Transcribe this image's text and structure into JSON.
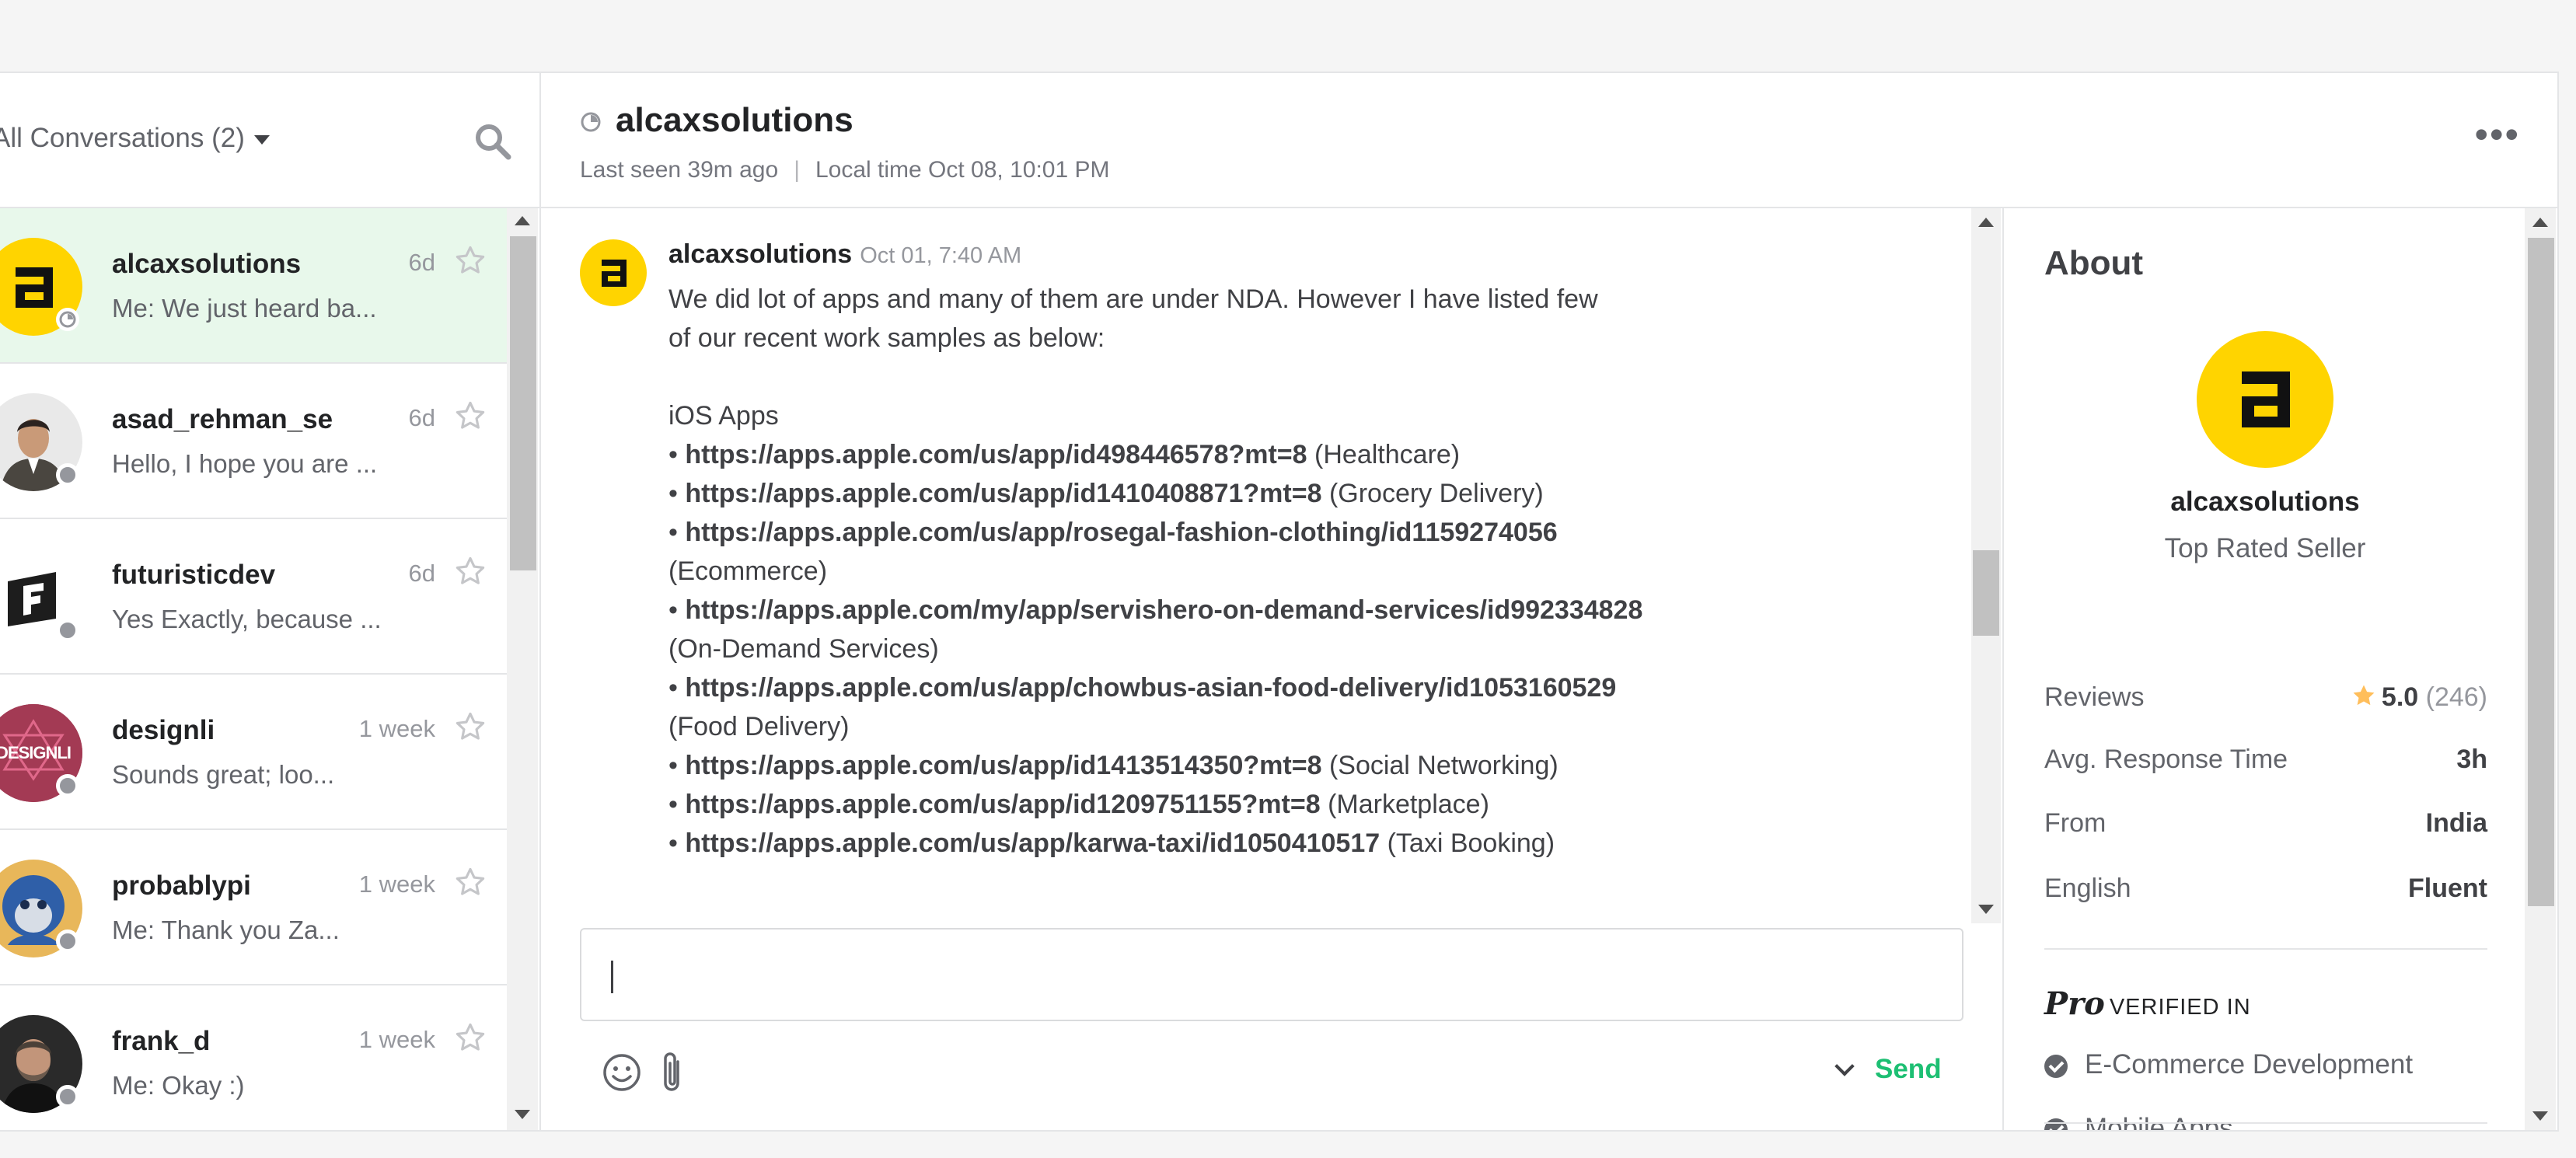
{
  "left_pane": {
    "filter_label": "All Conversations (2)",
    "conversations": [
      {
        "username": "alcaxsolutions",
        "when": "6d",
        "preview": "Me: We just heard ba...",
        "active": true
      },
      {
        "username": "asad_rehman_se",
        "when": "6d",
        "preview": "Hello, I hope you are ...",
        "active": false
      },
      {
        "username": "futuristicdev",
        "when": "6d",
        "preview": "Yes Exactly, because ...",
        "active": false
      },
      {
        "username": "designli",
        "when": "1 week",
        "preview": "Sounds great; loo...",
        "active": false
      },
      {
        "username": "probablypi",
        "when": "1 week",
        "preview": "Me: Thank you Za...",
        "active": false
      },
      {
        "username": "frank_d",
        "when": "1 week",
        "preview": "Me: Okay :)",
        "active": false
      }
    ],
    "avatar_texts": {
      "designli": "DESIGNLI"
    }
  },
  "chat": {
    "title": "alcaxsolutions",
    "last_seen": "Last seen 39m ago",
    "separator": "|",
    "local_time": "Local time Oct 08, 10:01 PM",
    "more": "•••",
    "message": {
      "sender": "alcaxsolutions",
      "time": "Oct 01, 7:40 AM",
      "intro_1": "We did lot of apps and many of them are under NDA. However I have listed few",
      "intro_2": "of our recent work samples as below:",
      "section": "iOS Apps",
      "items": [
        {
          "link": "https://apps.apple.com/us/app/id498446578?mt=8",
          "label": "(Healthcare)",
          "wrap": false
        },
        {
          "link": "https://apps.apple.com/us/app/id1410408871?mt=8",
          "label": "(Grocery Delivery)",
          "wrap": false
        },
        {
          "link": "https://apps.apple.com/us/app/rosegal-fashion-clothing/id1159274056",
          "label": "(Ecommerce)",
          "wrap": true
        },
        {
          "link": "https://apps.apple.com/my/app/servishero-on-demand-services/id992334828",
          "label": "(On-Demand Services)",
          "wrap": true
        },
        {
          "link": "https://apps.apple.com/us/app/chowbus-asian-food-delivery/id1053160529",
          "label": "(Food Delivery)",
          "wrap": true
        },
        {
          "link": "https://apps.apple.com/us/app/id1413514350?mt=8",
          "label": "(Social Networking)",
          "wrap": false
        },
        {
          "link": "https://apps.apple.com/us/app/id1209751155?mt=8",
          "label": "(Marketplace)",
          "wrap": false
        },
        {
          "link": "https://apps.apple.com/us/app/karwa-taxi/id1050410517",
          "label": "(Taxi Booking)",
          "wrap": false
        }
      ]
    },
    "composer": {
      "value": ""
    },
    "send_label": "Send"
  },
  "about": {
    "heading": "About",
    "name": "alcaxsolutions",
    "level": "Top Rated Seller",
    "stats": [
      {
        "key": "Reviews",
        "value": "5.0",
        "count": "(246)",
        "star": true
      },
      {
        "key": "Avg. Response Time",
        "value": "3h"
      },
      {
        "key": "From",
        "value": "India"
      },
      {
        "key": "English",
        "value": "Fluent"
      }
    ],
    "pro_logo": "Pro",
    "pro_text": "VERIFIED IN",
    "verified": [
      "E-Commerce Development",
      "Mobile Apps"
    ]
  },
  "colors": {
    "accent_green": "#1dbf73",
    "active_row": "#e8f8eb",
    "brand_yellow": "#ffd400",
    "star_gold": "#ffbe5b"
  }
}
